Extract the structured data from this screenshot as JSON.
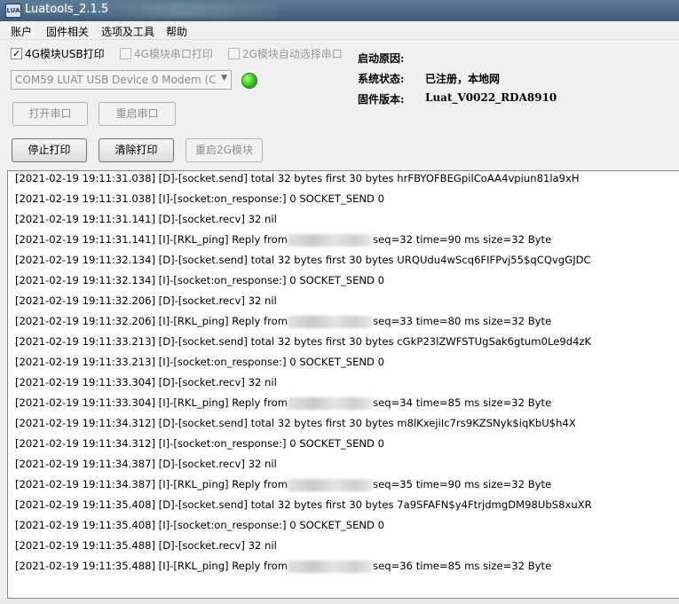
{
  "window": {
    "title": "Luatools_2.1.5",
    "icon_text": "LUA"
  },
  "menu": [
    "账户",
    "固件相关",
    "选项及工具",
    "帮助"
  ],
  "options": {
    "usb_print": {
      "label": "4G模块USB打印",
      "checked": true
    },
    "serial_print": {
      "label": "4G模块串口打印",
      "checked": false
    },
    "auto_select_2g": {
      "label": "2G模块自动选择串口",
      "checked": false
    }
  },
  "port_select": {
    "value": "COM59 LUAT USB Device 0 Modem (C"
  },
  "status": {
    "boot_reason_label": "启动原因:",
    "boot_reason_value": "",
    "system_state_label": "系统状态:",
    "system_state_value": "已注册，本地网",
    "firmware_label": "固件版本:",
    "firmware_value": "Luat_V0022_RDA8910"
  },
  "buttons": {
    "open_port": "打开串口",
    "restart_port": "重启串口",
    "stop_print": "停止打印",
    "clear_print": "清除打印",
    "restart_2g": "重启2G模块"
  },
  "log": [
    {
      "prefix": "[2021-02-19 19:11:31.038] [D]-[socket.send] total 32 bytes first 30 bytes hrFBYOFBEGpilCoAA4vpiun81la9xH",
      "suffix": ""
    },
    {
      "prefix": "[2021-02-19 19:11:31.038] [I]-[socket:on_response:] 0 SOCKET_SEND 0",
      "suffix": ""
    },
    {
      "prefix": "[2021-02-19 19:11:31.141] [D]-[socket.recv] 32 nil",
      "suffix": ""
    },
    {
      "prefix": "[2021-02-19 19:11:31.141] [I]-[RKL_ping] Reply from",
      "suffix": "seq=32 time=90 ms size=32 Byte",
      "redacted": true
    },
    {
      "prefix": "[2021-02-19 19:11:32.134] [D]-[socket.send] total 32 bytes first 30 bytes URQUdu4wScq6FIFPvj55$qCQvgGJDC",
      "suffix": ""
    },
    {
      "prefix": "[2021-02-19 19:11:32.134] [I]-[socket:on_response:] 0 SOCKET_SEND 0",
      "suffix": ""
    },
    {
      "prefix": "[2021-02-19 19:11:32.206] [D]-[socket.recv] 32 nil",
      "suffix": ""
    },
    {
      "prefix": "[2021-02-19 19:11:32.206] [I]-[RKL_ping] Reply from",
      "suffix": "seq=33 time=80 ms size=32 Byte",
      "redacted": true
    },
    {
      "prefix": "[2021-02-19 19:11:33.213] [D]-[socket.send] total 32 bytes first 30 bytes cGkP23lZWFSTUgSak6gtum0Le9d4zK",
      "suffix": ""
    },
    {
      "prefix": "[2021-02-19 19:11:33.213] [I]-[socket:on_response:] 0 SOCKET_SEND 0",
      "suffix": ""
    },
    {
      "prefix": "[2021-02-19 19:11:33.304] [D]-[socket.recv] 32 nil",
      "suffix": ""
    },
    {
      "prefix": "[2021-02-19 19:11:33.304] [I]-[RKL_ping] Reply from",
      "suffix": "seq=34 time=85 ms size=32 Byte",
      "redacted": true
    },
    {
      "prefix": "[2021-02-19 19:11:34.312] [D]-[socket.send] total 32 bytes first 30 bytes m8lKxejiIc7rs9KZSNyk$iqKbU$h4X",
      "suffix": ""
    },
    {
      "prefix": "[2021-02-19 19:11:34.312] [I]-[socket:on_response:] 0 SOCKET_SEND 0",
      "suffix": ""
    },
    {
      "prefix": "[2021-02-19 19:11:34.387] [D]-[socket.recv] 32 nil",
      "suffix": ""
    },
    {
      "prefix": "[2021-02-19 19:11:34.387] [I]-[RKL_ping] Reply from",
      "suffix": "seq=35 time=90 ms size=32 Byte",
      "redacted": true
    },
    {
      "prefix": "[2021-02-19 19:11:35.408] [D]-[socket.send] total 32 bytes first 30 bytes 7a9SFAFN$y4FtrjdmgDM98UbS8xuXR",
      "suffix": ""
    },
    {
      "prefix": "[2021-02-19 19:11:35.408] [I]-[socket:on_response:] 0 SOCKET_SEND 0",
      "suffix": ""
    },
    {
      "prefix": "[2021-02-19 19:11:35.488] [D]-[socket.recv] 32 nil",
      "suffix": ""
    },
    {
      "prefix": "[2021-02-19 19:11:35.488] [I]-[RKL_ping] Reply from",
      "suffix": "seq=36 time=85 ms size=32 Byte",
      "redacted": true
    }
  ]
}
